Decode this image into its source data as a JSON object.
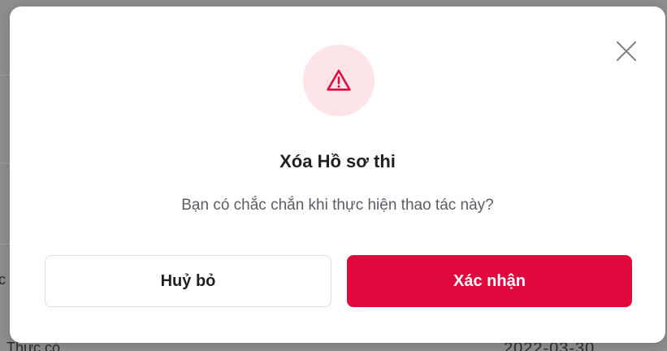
{
  "background": {
    "left_fragment": "c",
    "bottom_left_fragment": "Thực có",
    "bottom_right_fragment": "2022-03-30"
  },
  "dialog": {
    "title": "Xóa Hồ sơ thi",
    "message": "Bạn có chắc chắn khi thực hiện thao tác này?",
    "cancel_label": "Huỷ bỏ",
    "confirm_label": "Xác nhận",
    "icon": "warning-triangle-icon",
    "close_icon": "close-icon"
  },
  "colors": {
    "accent": "#e0083d",
    "icon_bg": "#fde4e8",
    "icon_stroke": "#e0083d"
  }
}
